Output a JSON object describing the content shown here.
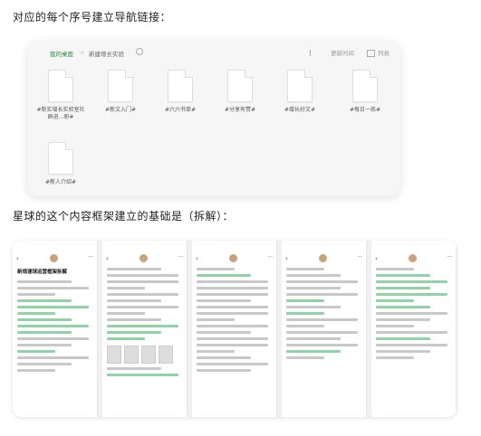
{
  "headings": {
    "first": "对应的每个序号建立导航链接：",
    "second": "星球的这个内容框架建立的基础是（拆解）："
  },
  "window": {
    "breadcrumb_root": "我的桌面",
    "breadcrumb_sep": ">",
    "breadcrumb_current": "新建增长实验",
    "tb_sort": "更新时间",
    "tb_view": "列表",
    "files": [
      "#新实增长实验室社群进...册#",
      "#新文入门#",
      "#六六书单#",
      "#分享有赞#",
      "#增长好文#",
      "#每日一练#",
      "#新人介绍#"
    ]
  },
  "phones": {
    "title_1": "新规速球运营框架拆解"
  }
}
